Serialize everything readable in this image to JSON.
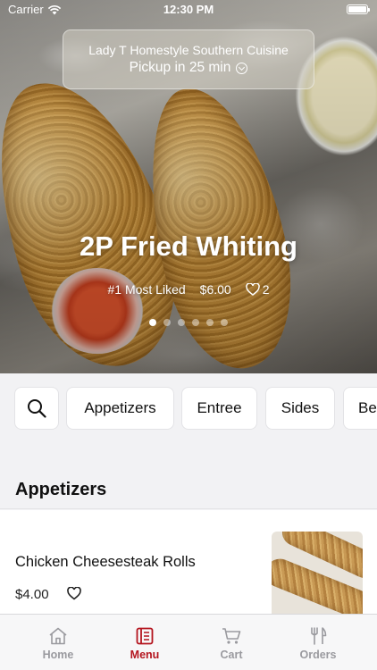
{
  "status_bar": {
    "carrier": "Carrier",
    "time": "12:30 PM"
  },
  "store": {
    "name": "Lady T Homestyle Southern Cuisine",
    "pickup": "Pickup in 25 min"
  },
  "featured": {
    "title": "2P Fried Whiting",
    "rank": "#1 Most Liked",
    "price": "$6.00",
    "likes": "2",
    "slide_index": 1,
    "slide_count": 6
  },
  "categories": {
    "search_icon": "search-icon",
    "items": [
      "Appetizers",
      "Entree",
      "Sides",
      "Be"
    ]
  },
  "section": {
    "title": "Appetizers"
  },
  "menu_items": [
    {
      "name": "Chicken Cheesesteak Rolls",
      "price": "$4.00"
    }
  ],
  "tabbar": {
    "tabs": [
      {
        "label": "Home",
        "icon": "home-icon"
      },
      {
        "label": "Menu",
        "icon": "menu-icon"
      },
      {
        "label": "Cart",
        "icon": "cart-icon"
      },
      {
        "label": "Orders",
        "icon": "orders-icon"
      }
    ],
    "active": "Menu"
  },
  "colors": {
    "accent": "#b4141e",
    "inactive": "#9a9a9f",
    "background": "#f2f2f4"
  }
}
